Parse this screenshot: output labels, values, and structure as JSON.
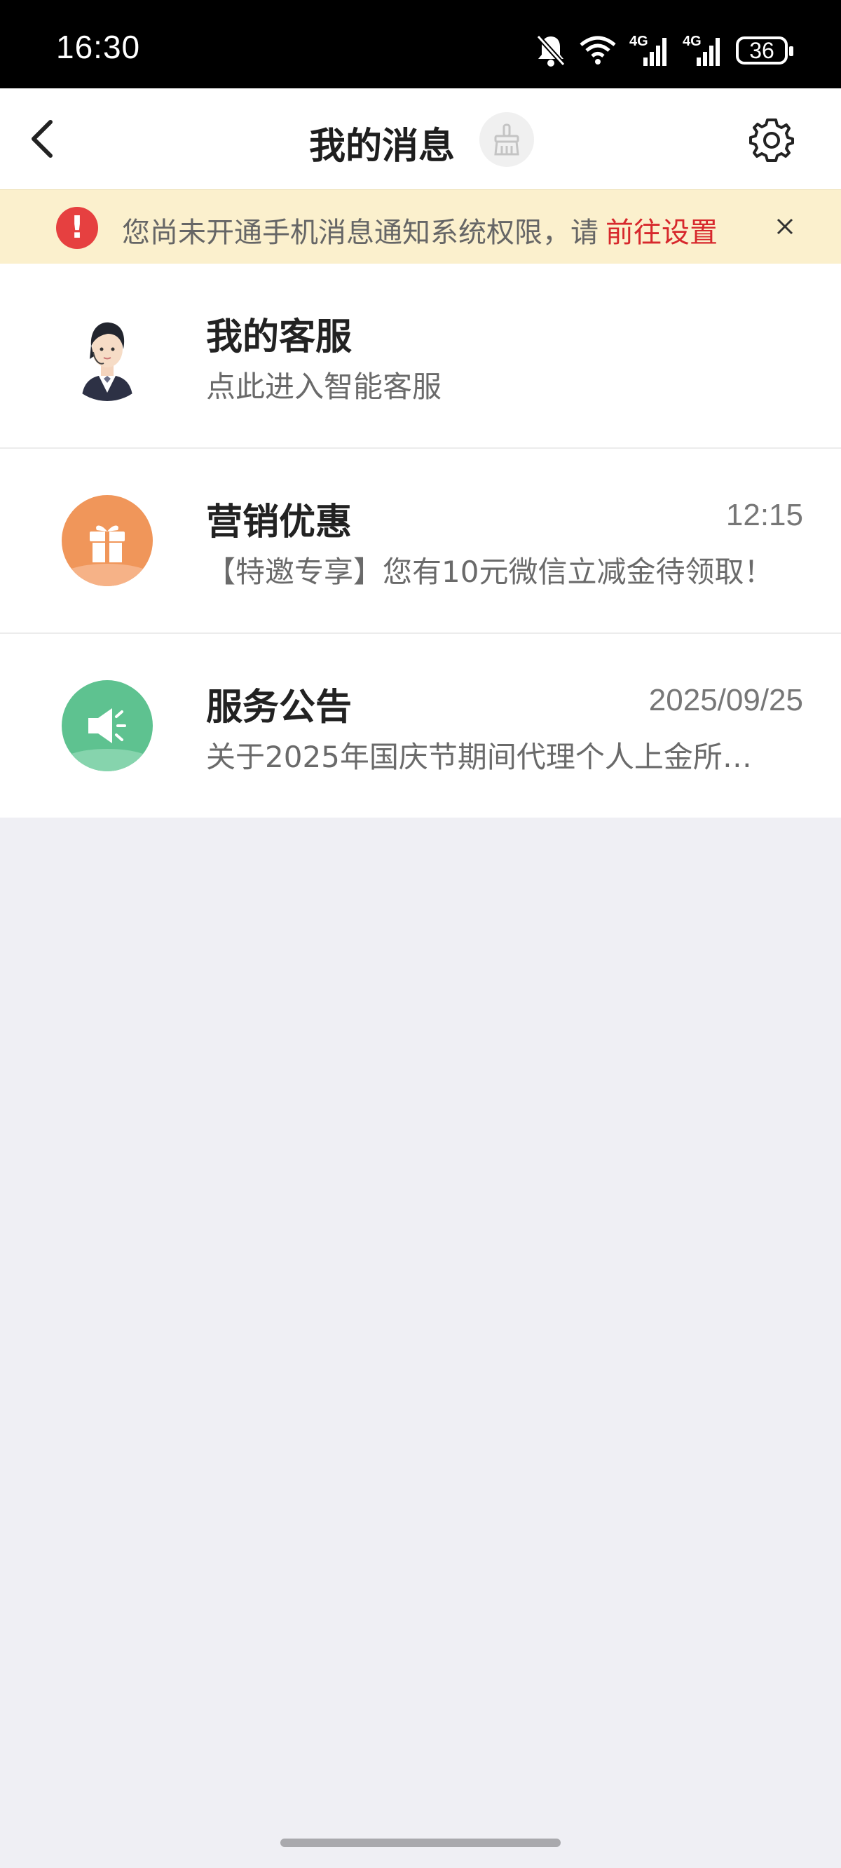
{
  "status_bar": {
    "time": "16:30",
    "battery": "36",
    "network_1": "4G",
    "network_2": "4G",
    "icons": [
      "bell-off-icon",
      "wifi-icon",
      "signal-4g-icon",
      "signal-4g-icon",
      "battery-icon"
    ]
  },
  "nav": {
    "title": "我的消息",
    "icons": [
      "back-arrow-icon",
      "broom-icon",
      "gear-icon"
    ]
  },
  "notice": {
    "text": "您尚未开通手机消息通知系统权限，请",
    "link": "前往设置",
    "accent_color": "#d7282c"
  },
  "messages": [
    {
      "title": "我的客服",
      "subtitle": "点此进入智能客服",
      "time": ""
    },
    {
      "title": "营销优惠",
      "subtitle": "【特邀专享】您有10元微信立减金待领取！",
      "time": "12:15"
    },
    {
      "title": "服务公告",
      "subtitle": "关于2025年国庆节期间代理个人上金所…",
      "time": "2025/09/25"
    }
  ],
  "colors": {
    "promo_icon_bg": "#f0965a",
    "notice_icon_bg": "#5ec290",
    "alert_red": "#e64040",
    "page_bg": "#efeff4"
  }
}
